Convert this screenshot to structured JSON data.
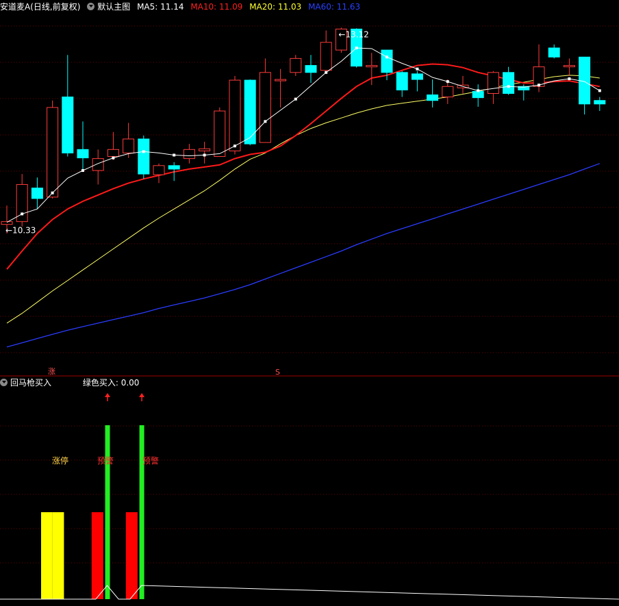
{
  "header": {
    "title": "安道麦A(日线,前复权)",
    "template": "默认主图",
    "ma5": "MA5: 11.14",
    "ma10": "MA10: 11.09",
    "ma20": "MA20: 11.03",
    "ma60": "MA60: 11.63"
  },
  "lower_header": {
    "indicator": "回马枪买入",
    "value": "绿色买入: 0.00"
  },
  "colors": {
    "up": "#ff3c3c",
    "down": "#00ffff",
    "ma5": "#ffffff",
    "ma10": "#ff1a1a",
    "ma20": "#ffff66",
    "ma60": "#2a3cff",
    "grid": "#6e0000",
    "yellow_bar": "#ffff00",
    "red_bar": "#ff0000",
    "green_bar": "#22ee22"
  },
  "chart_data": [
    {
      "type": "candlestick",
      "title": "安道麦A(日线,前复权)",
      "annotations": {
        "high": "13.12",
        "low": "10.33",
        "markers": [
          "涨",
          "S"
        ]
      },
      "candles": [
        {
          "o": 10.33,
          "c": 10.37,
          "h": 10.6,
          "l": 10.2
        },
        {
          "o": 10.37,
          "c": 10.9,
          "h": 11.05,
          "l": 10.3
        },
        {
          "o": 10.85,
          "c": 10.7,
          "h": 11.0,
          "l": 10.55
        },
        {
          "o": 10.72,
          "c": 12.0,
          "h": 12.1,
          "l": 10.7
        },
        {
          "o": 12.15,
          "c": 11.35,
          "h": 12.75,
          "l": 11.3
        },
        {
          "o": 11.4,
          "c": 11.28,
          "h": 11.8,
          "l": 11.1
        },
        {
          "o": 11.1,
          "c": 11.27,
          "h": 11.4,
          "l": 10.9
        },
        {
          "o": 11.3,
          "c": 11.4,
          "h": 11.65,
          "l": 11.25
        },
        {
          "o": 11.35,
          "c": 11.55,
          "h": 11.78,
          "l": 11.28
        },
        {
          "o": 11.55,
          "c": 11.05,
          "h": 11.6,
          "l": 10.98
        },
        {
          "o": 11.04,
          "c": 11.17,
          "h": 11.2,
          "l": 10.92
        },
        {
          "o": 11.17,
          "c": 11.12,
          "h": 11.22,
          "l": 10.95
        },
        {
          "o": 11.27,
          "c": 11.4,
          "h": 11.48,
          "l": 11.2
        },
        {
          "o": 11.38,
          "c": 11.41,
          "h": 11.51,
          "l": 11.2
        },
        {
          "o": 11.3,
          "c": 11.95,
          "h": 12.0,
          "l": 11.3
        },
        {
          "o": 11.38,
          "c": 12.39,
          "h": 12.45,
          "l": 11.33
        },
        {
          "o": 12.39,
          "c": 11.48,
          "h": 12.4,
          "l": 11.46
        },
        {
          "o": 11.5,
          "c": 12.5,
          "h": 12.7,
          "l": 11.5
        },
        {
          "o": 12.4,
          "c": 12.4,
          "h": 12.55,
          "l": 12.0
        },
        {
          "o": 12.5,
          "c": 12.7,
          "h": 12.75,
          "l": 12.45
        },
        {
          "o": 12.6,
          "c": 12.5,
          "h": 12.75,
          "l": 12.35
        },
        {
          "o": 12.53,
          "c": 12.93,
          "h": 13.1,
          "l": 12.5
        },
        {
          "o": 12.82,
          "c": 13.12,
          "h": 13.14,
          "l": 12.78
        },
        {
          "o": 13.12,
          "c": 12.59,
          "h": 13.13,
          "l": 12.57
        },
        {
          "o": 12.58,
          "c": 12.6,
          "h": 12.78,
          "l": 12.32
        },
        {
          "o": 12.82,
          "c": 12.5,
          "h": 12.82,
          "l": 12.39
        },
        {
          "o": 12.5,
          "c": 12.25,
          "h": 12.52,
          "l": 12.15
        },
        {
          "o": 12.48,
          "c": 12.4,
          "h": 12.52,
          "l": 12.23
        },
        {
          "o": 12.18,
          "c": 12.1,
          "h": 12.4,
          "l": 12.0
        },
        {
          "o": 12.15,
          "c": 12.3,
          "h": 12.4,
          "l": 12.05
        },
        {
          "o": 12.28,
          "c": 12.32,
          "h": 12.45,
          "l": 12.2
        },
        {
          "o": 12.23,
          "c": 12.14,
          "h": 12.33,
          "l": 12.01
        },
        {
          "o": 12.2,
          "c": 12.5,
          "h": 12.52,
          "l": 12.05
        },
        {
          "o": 12.5,
          "c": 12.2,
          "h": 12.58,
          "l": 12.18
        },
        {
          "o": 12.3,
          "c": 12.25,
          "h": 12.33,
          "l": 12.1
        },
        {
          "o": 12.3,
          "c": 12.58,
          "h": 12.9,
          "l": 12.22
        },
        {
          "o": 12.85,
          "c": 12.72,
          "h": 12.9,
          "l": 12.7
        },
        {
          "o": 12.6,
          "c": 12.6,
          "h": 12.7,
          "l": 12.45
        },
        {
          "o": 12.72,
          "c": 12.05,
          "h": 12.72,
          "l": 11.9
        },
        {
          "o": 12.1,
          "c": 12.05,
          "h": 12.15,
          "l": 11.95
        }
      ],
      "ma5": [
        10.36,
        10.48,
        10.55,
        10.78,
        10.99,
        11.1,
        11.2,
        11.28,
        11.34,
        11.37,
        11.35,
        11.32,
        11.31,
        11.32,
        11.34,
        11.45,
        11.57,
        11.8,
        11.96,
        12.12,
        12.31,
        12.5,
        12.66,
        12.85,
        12.84,
        12.72,
        12.63,
        12.55,
        12.43,
        12.37,
        12.3,
        12.24,
        12.27,
        12.3,
        12.29,
        12.32,
        12.38,
        12.41,
        12.37,
        12.24
      ],
      "ma10": [
        9.69,
        9.95,
        10.2,
        10.4,
        10.55,
        10.66,
        10.75,
        10.84,
        10.92,
        10.98,
        11.03,
        11.08,
        11.12,
        11.15,
        11.18,
        11.27,
        11.33,
        11.36,
        11.45,
        11.6,
        11.77,
        11.95,
        12.13,
        12.3,
        12.42,
        12.46,
        12.53,
        12.6,
        12.62,
        12.61,
        12.57,
        12.5,
        12.45,
        12.4,
        12.35,
        12.35,
        12.37,
        12.38,
        12.34,
        12.3
      ],
      "ma20": [
        8.92,
        9.06,
        9.22,
        9.38,
        9.53,
        9.68,
        9.83,
        9.98,
        10.13,
        10.28,
        10.42,
        10.55,
        10.68,
        10.81,
        10.96,
        11.12,
        11.26,
        11.35,
        11.48,
        11.6,
        11.7,
        11.78,
        11.85,
        11.92,
        11.98,
        12.03,
        12.06,
        12.09,
        12.12,
        12.15,
        12.19,
        12.23,
        12.28,
        12.33,
        12.36,
        12.4,
        12.44,
        12.46,
        12.45,
        12.42
      ],
      "ma60": [
        8.58,
        8.64,
        8.7,
        8.76,
        8.82,
        8.87,
        8.92,
        8.97,
        9.02,
        9.07,
        9.13,
        9.18,
        9.23,
        9.28,
        9.34,
        9.4,
        9.47,
        9.55,
        9.63,
        9.71,
        9.79,
        9.87,
        9.95,
        10.04,
        10.12,
        10.2,
        10.27,
        10.34,
        10.41,
        10.48,
        10.55,
        10.62,
        10.69,
        10.76,
        10.83,
        10.9,
        10.97,
        11.04,
        11.12,
        11.2
      ]
    },
    {
      "type": "bar",
      "title": "回马枪买入",
      "labels": [
        "涨停",
        "预警",
        "预警"
      ],
      "bars": [
        {
          "i": 1,
          "kind": "yellow",
          "value": 1.0
        },
        {
          "i": 2,
          "kind": "yellow",
          "value": 1.0
        },
        {
          "i": 4,
          "kind": "red",
          "value": 1.0
        },
        {
          "i": 5,
          "kind": "green",
          "value": 2.0
        },
        {
          "i": 7,
          "kind": "red",
          "value": 1.0
        },
        {
          "i": 8,
          "kind": "green",
          "value": 2.0
        }
      ],
      "signal_line": [
        0,
        0,
        0,
        0,
        0,
        0.4,
        0,
        0,
        0.4,
        0
      ],
      "buy_arrows": [
        5,
        8
      ]
    }
  ]
}
